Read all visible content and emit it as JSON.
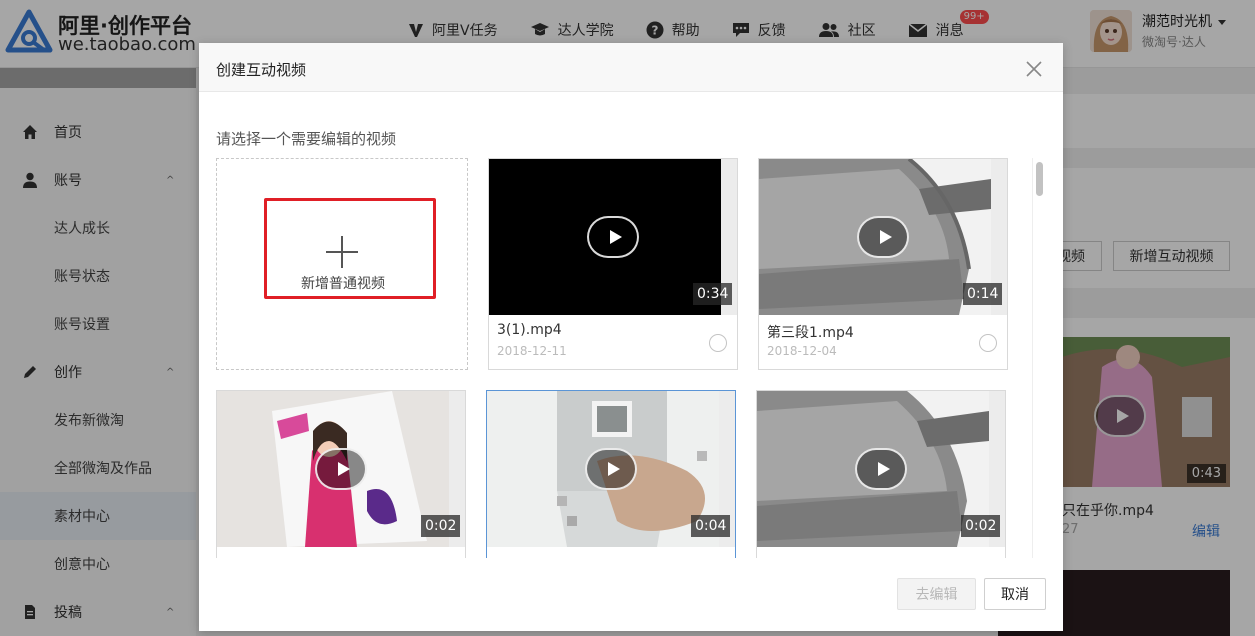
{
  "brand": {
    "title": "阿里·创作平台",
    "subtitle": "we.taobao.com",
    "accent": "#3a7bd5"
  },
  "nav": {
    "items": [
      {
        "label": "阿里V任务",
        "icon": "v-icon"
      },
      {
        "label": "达人学院",
        "icon": "graduation-cap-icon"
      },
      {
        "label": "帮助",
        "icon": "help-icon"
      },
      {
        "label": "反馈",
        "icon": "feedback-icon"
      },
      {
        "label": "社区",
        "icon": "community-icon"
      },
      {
        "label": "消息",
        "icon": "mail-icon"
      }
    ],
    "message_badge": "99+"
  },
  "user": {
    "name": "潮范时光机",
    "role": "微淘号·达人"
  },
  "sidebar": {
    "items": [
      {
        "label": "首页",
        "icon": "home-icon",
        "level": "top"
      },
      {
        "label": "账号",
        "icon": "user-icon",
        "level": "top",
        "expanded": true
      },
      {
        "label": "达人成长",
        "level": "sub"
      },
      {
        "label": "账号状态",
        "level": "sub"
      },
      {
        "label": "账号设置",
        "level": "sub"
      },
      {
        "label": "创作",
        "icon": "pencil-icon",
        "level": "top",
        "expanded": true
      },
      {
        "label": "发布新微淘",
        "level": "sub"
      },
      {
        "label": "全部微淘及作品",
        "level": "sub"
      },
      {
        "label": "素材中心",
        "level": "sub",
        "active": true
      },
      {
        "label": "创意中心",
        "level": "sub"
      },
      {
        "label": "投稿",
        "icon": "document-icon",
        "level": "top",
        "expanded": true
      }
    ]
  },
  "background_page": {
    "btn_partial": "视频",
    "btn_add_interactive": "新增互动视频",
    "video_duration": "0:43",
    "video_name_partial": "只在乎你.mp4",
    "video_date_partial": "27",
    "edit_link": "编辑"
  },
  "modal": {
    "title": "创建互动视频",
    "prompt": "请选择一个需要编辑的视频",
    "add_card_label": "新增普通视频",
    "videos": [
      {
        "name": "3(1).mp4",
        "date": "2018-12-11",
        "duration": "0:34"
      },
      {
        "name": "第三段1.mp4",
        "date": "2018-12-04",
        "duration": "0:14"
      },
      {
        "name": "",
        "date": "",
        "duration": "0:02"
      },
      {
        "name": "",
        "date": "",
        "duration": "0:04"
      },
      {
        "name": "",
        "date": "",
        "duration": "0:02"
      }
    ],
    "edit_button": "去编辑",
    "cancel_button": "取消"
  }
}
